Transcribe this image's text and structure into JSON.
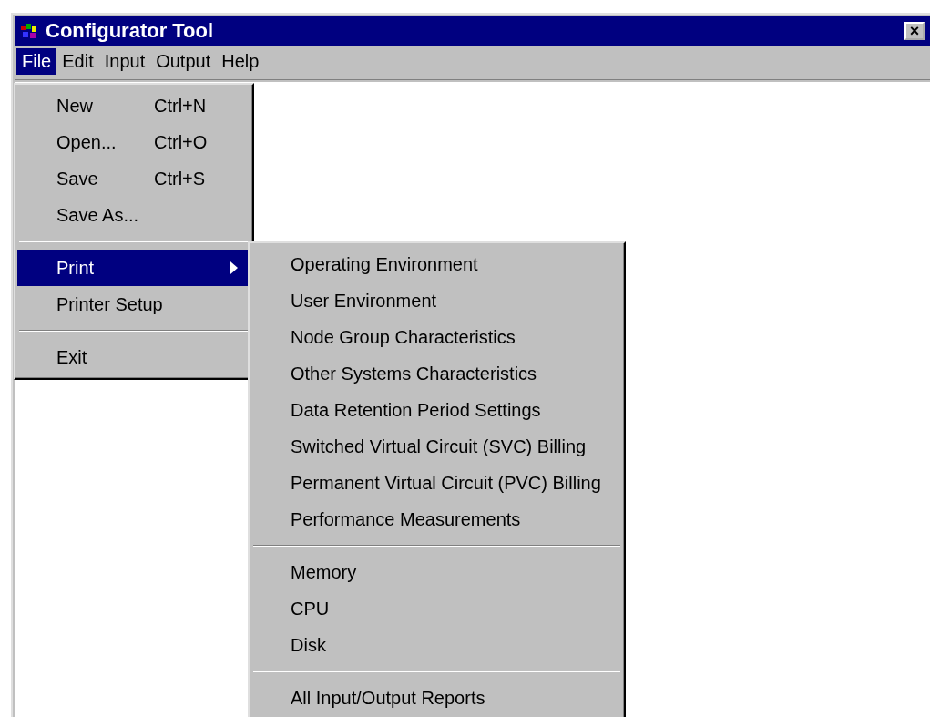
{
  "window": {
    "title": "Configurator Tool",
    "close_glyph": "×"
  },
  "menubar": [
    {
      "label": "File",
      "selected": true
    },
    {
      "label": "Edit",
      "selected": false
    },
    {
      "label": "Input",
      "selected": false
    },
    {
      "label": "Output",
      "selected": false
    },
    {
      "label": "Help",
      "selected": false
    }
  ],
  "file_menu": [
    {
      "kind": "item",
      "label": "New",
      "shortcut": "Ctrl+N",
      "selected": false
    },
    {
      "kind": "item",
      "label": "Open...",
      "shortcut": "Ctrl+O",
      "selected": false
    },
    {
      "kind": "item",
      "label": "Save",
      "shortcut": "Ctrl+S",
      "selected": false
    },
    {
      "kind": "item",
      "label": "Save As...",
      "selected": false
    },
    {
      "kind": "separator"
    },
    {
      "kind": "submenu",
      "label": "Print",
      "selected": true
    },
    {
      "kind": "item",
      "label": "Printer Setup",
      "selected": false
    },
    {
      "kind": "separator"
    },
    {
      "kind": "item",
      "label": "Exit",
      "selected": false
    }
  ],
  "print_submenu": [
    {
      "kind": "item",
      "label": "Operating Environment"
    },
    {
      "kind": "item",
      "label": "User Environment"
    },
    {
      "kind": "item",
      "label": "Node Group Characteristics"
    },
    {
      "kind": "item",
      "label": "Other Systems Characteristics"
    },
    {
      "kind": "item",
      "label": "Data Retention Period Settings"
    },
    {
      "kind": "item",
      "label": "Switched Virtual Circuit (SVC) Billing"
    },
    {
      "kind": "item",
      "label": "Permanent Virtual Circuit (PVC) Billing"
    },
    {
      "kind": "item",
      "label": "Performance Measurements"
    },
    {
      "kind": "separator"
    },
    {
      "kind": "item",
      "label": "Memory"
    },
    {
      "kind": "item",
      "label": "CPU"
    },
    {
      "kind": "item",
      "label": "Disk"
    },
    {
      "kind": "separator"
    },
    {
      "kind": "item",
      "label": "All Input/Output Reports"
    }
  ]
}
